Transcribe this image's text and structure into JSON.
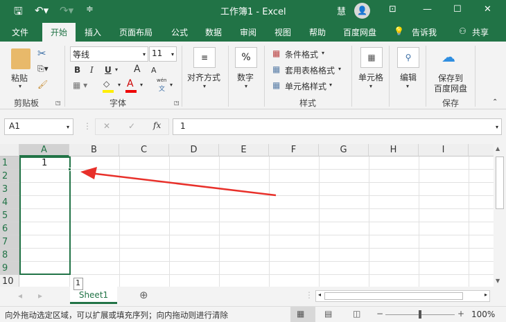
{
  "window": {
    "title": "工作簿1 - Excel",
    "user": "慧",
    "colors": {
      "brand": "#217346",
      "arrow": "#e8302a"
    }
  },
  "qat": {
    "save": "save-icon",
    "undo": "undo-icon",
    "redo": "redo-icon",
    "customize": "customize-icon"
  },
  "tabs": [
    "文件",
    "开始",
    "插入",
    "页面布局",
    "公式",
    "数据",
    "审阅",
    "视图",
    "帮助",
    "百度网盘"
  ],
  "tell_me": "告诉我",
  "share": "共享",
  "ribbon": {
    "clipboard": {
      "paste": "粘贴",
      "group": "剪贴板"
    },
    "font": {
      "name": "等线",
      "size": "11",
      "bold": "B",
      "italic": "I",
      "underline": "U",
      "grow": "A",
      "shrink": "A",
      "color_a": "A",
      "phonetic_top": "wén",
      "phonetic_bottom": "文",
      "group": "字体"
    },
    "alignment": {
      "label": "对齐方式"
    },
    "number": {
      "icon": "%",
      "label": "数字"
    },
    "styles": {
      "conditional": "条件格式",
      "table": "套用表格格式",
      "cell": "单元格样式",
      "group": "样式"
    },
    "cells": {
      "label": "单元格"
    },
    "editing": {
      "label": "编辑"
    },
    "save": {
      "line1": "保存到",
      "line2": "百度网盘",
      "group": "保存"
    }
  },
  "formula_bar": {
    "name_box": "A1",
    "fx": "fx",
    "value": "1"
  },
  "grid": {
    "columns": [
      "A",
      "B",
      "C",
      "D",
      "E",
      "F",
      "G",
      "H",
      "I"
    ],
    "rows": [
      "1",
      "2",
      "3",
      "4",
      "5",
      "6",
      "7",
      "8",
      "9",
      "10"
    ],
    "cell_a1": "1",
    "fill_tooltip": "1"
  },
  "sheets": [
    "Sheet1"
  ],
  "status": {
    "message": "向外拖动选定区域，可以扩展或填充序列；向内拖动则进行清除",
    "zoom": "100%",
    "zoom_fraction": 0.5
  }
}
